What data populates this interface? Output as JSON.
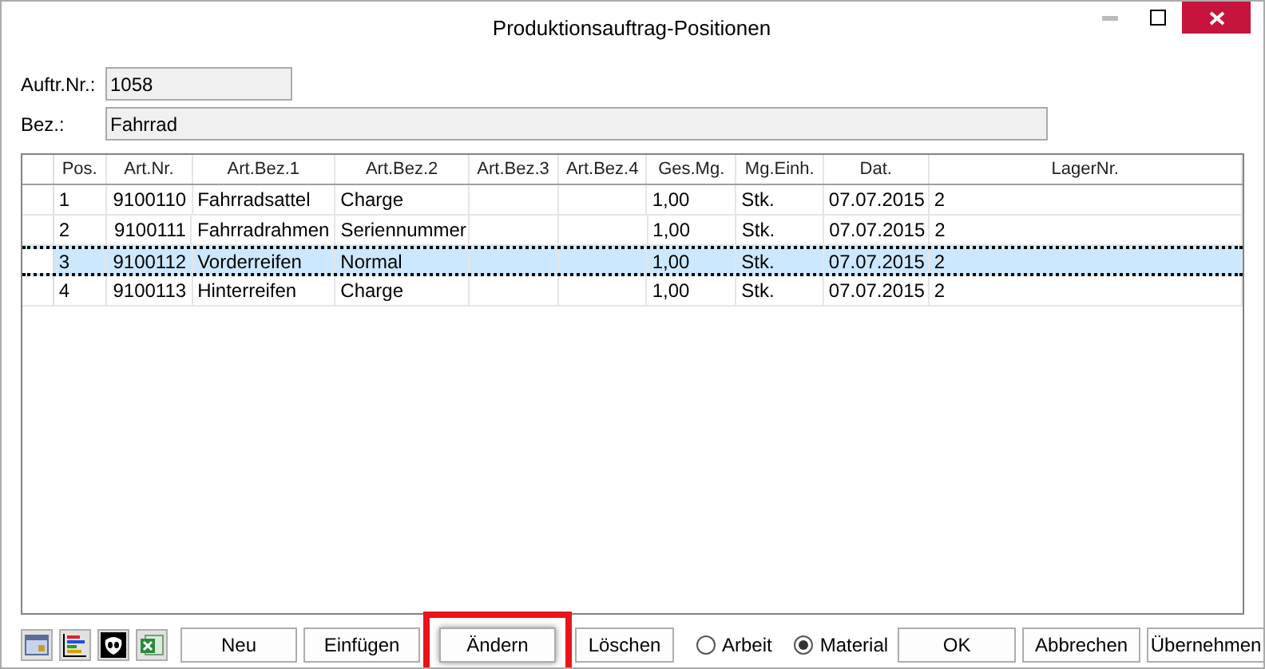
{
  "window": {
    "title": "Produktionsauftrag-Positionen"
  },
  "fields": [
    {
      "label": "Auftr.Nr.:",
      "value": "1058"
    },
    {
      "label": "Bez.:",
      "value": "Fahrrad"
    }
  ],
  "table": {
    "columns": [
      "Pos.",
      "Art.Nr.",
      "Art.Bez.1",
      "Art.Bez.2",
      "Art.Bez.3",
      "Art.Bez.4",
      "Ges.Mg.",
      "Mg.Einh.",
      "Dat.",
      "LagerNr."
    ],
    "rows": [
      {
        "selected": false,
        "cells": [
          "1",
          "9100110",
          "Fahrradsattel",
          "Charge",
          "",
          "",
          "1,00",
          "Stk.",
          "07.07.2015",
          "2"
        ]
      },
      {
        "selected": false,
        "cells": [
          "2",
          "9100111",
          "Fahrradrahmen",
          "Seriennummer",
          "",
          "",
          "1,00",
          "Stk.",
          "07.07.2015",
          "2"
        ]
      },
      {
        "selected": true,
        "cells": [
          "3",
          "9100112",
          "Vorderreifen",
          "Normal",
          "",
          "",
          "1,00",
          "Stk.",
          "07.07.2015",
          "2"
        ]
      },
      {
        "selected": false,
        "cells": [
          "4",
          "9100113",
          "Hinterreifen",
          "Charge",
          "",
          "",
          "1,00",
          "Stk.",
          "07.07.2015",
          "2"
        ]
      }
    ]
  },
  "actions": [
    {
      "label": "Neu",
      "highlighted": false
    },
    {
      "label": "Einfügen",
      "highlighted": false
    },
    {
      "label": "Ändern",
      "highlighted": true
    },
    {
      "label": "Löschen",
      "highlighted": false
    }
  ],
  "radios": [
    {
      "label": "Arbeit",
      "selected": false
    },
    {
      "label": "Material",
      "selected": true
    }
  ],
  "buttons": [
    "OK",
    "Abbrechen",
    "Übernehmen"
  ]
}
